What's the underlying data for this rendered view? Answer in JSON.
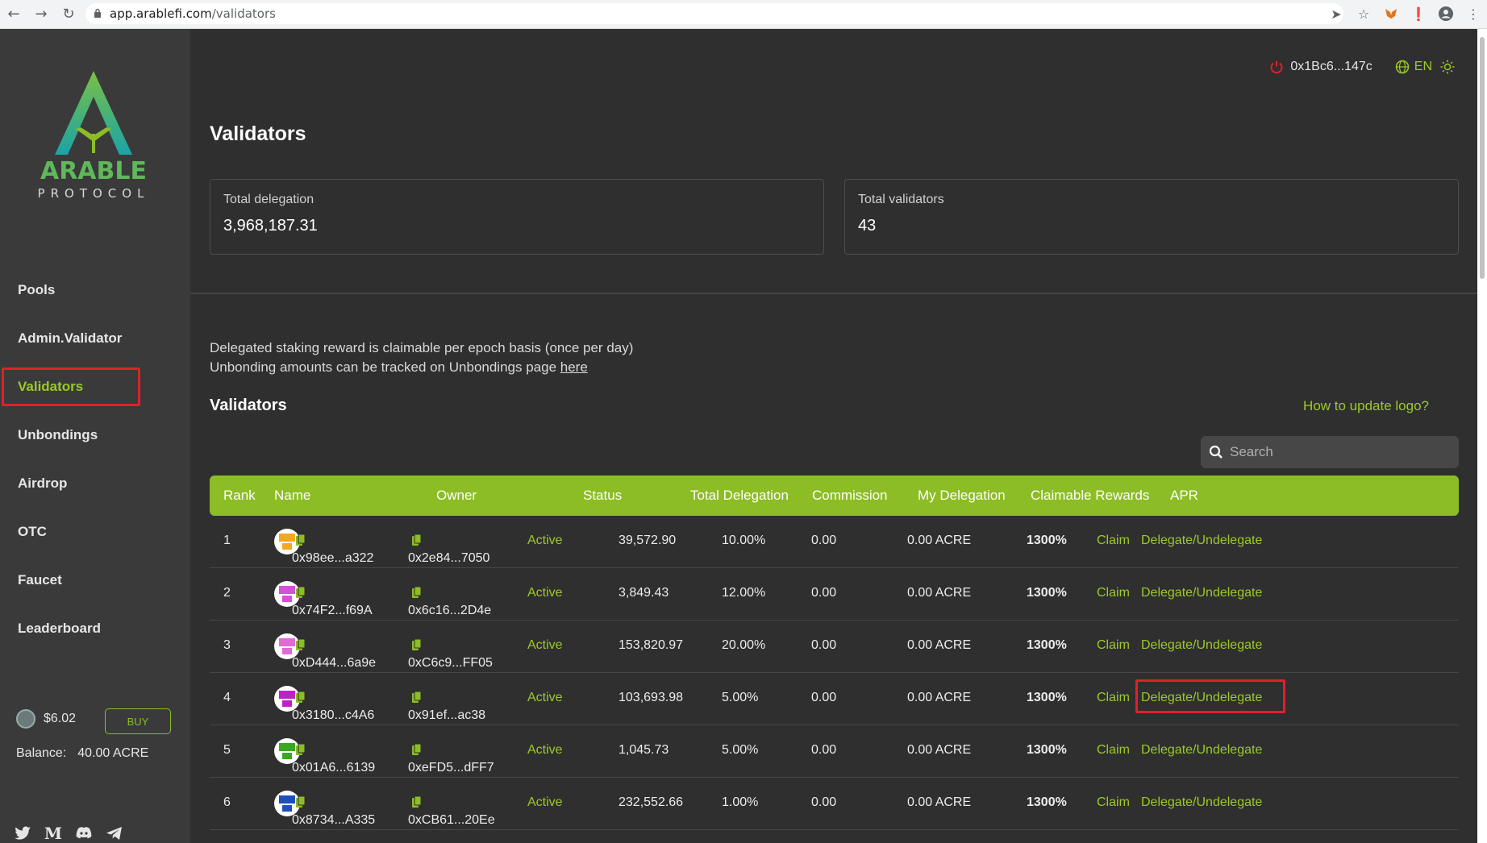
{
  "browser": {
    "domain": "app.arablefi.com",
    "path": "/validators"
  },
  "sidebar": {
    "logo_text": "ARABLE",
    "logo_sub": "PROTOCOL",
    "items": [
      {
        "label": "Pools"
      },
      {
        "label": "Admin.Validator"
      },
      {
        "label": "Validators"
      },
      {
        "label": "Unbondings"
      },
      {
        "label": "Airdrop"
      },
      {
        "label": "OTC"
      },
      {
        "label": "Faucet"
      },
      {
        "label": "Leaderboard"
      }
    ],
    "active_index": 2,
    "price": "$6.02",
    "buy_label": "BUY",
    "balance_label": "Balance:",
    "balance_value": "40.00 ACRE",
    "socials": [
      "twitter-icon",
      "medium-icon",
      "discord-icon",
      "telegram-icon"
    ]
  },
  "header": {
    "wallet": "0x1Bc6...147c",
    "lang": "EN"
  },
  "page": {
    "title": "Validators",
    "total_delegation_label": "Total delegation",
    "total_delegation_value": "3,968,187.31",
    "total_validators_label": "Total validators",
    "total_validators_value": "43",
    "note_line1": "Delegated staking reward is claimable per epoch basis (once per day)",
    "note_line2_prefix": "Unbonding amounts can be tracked on Unbondings page",
    "note_link": "here",
    "section_title": "Validators",
    "update_logo_link": "How to update logo?",
    "search_placeholder": "Search"
  },
  "table": {
    "headers": {
      "rank": "Rank",
      "name": "Name",
      "owner": "Owner",
      "status": "Status",
      "total_delegation": "Total Delegation",
      "commission": "Commission",
      "my_delegation": "My Delegation",
      "claimable_rewards": "Claimable Rewards",
      "apr": "APR"
    },
    "claim_label": "Claim",
    "delegate_label": "Delegate/Undelegate",
    "rows": [
      {
        "rank": "1",
        "name": "0x98ee...a322",
        "owner": "0x2e84...7050",
        "status": "Active",
        "total": "39,572.90",
        "commission": "10.00%",
        "my": "0.00",
        "rewards": "0.00 ACRE",
        "apr": "1300%",
        "avatar_color": "#f5a623"
      },
      {
        "rank": "2",
        "name": "0x74F2...f69A",
        "owner": "0x6c16...2D4e",
        "status": "Active",
        "total": "3,849.43",
        "commission": "12.00%",
        "my": "0.00",
        "rewards": "0.00 ACRE",
        "apr": "1300%",
        "avatar_color": "#d64fd6"
      },
      {
        "rank": "3",
        "name": "0xD444...6a9e",
        "owner": "0xC6c9...FF05",
        "status": "Active",
        "total": "153,820.97",
        "commission": "20.00%",
        "my": "0.00",
        "rewards": "0.00 ACRE",
        "apr": "1300%",
        "avatar_color": "#e06ad8"
      },
      {
        "rank": "4",
        "name": "0x3180...c4A6",
        "owner": "0x91ef...ac38",
        "status": "Active",
        "total": "103,693.98",
        "commission": "5.00%",
        "my": "0.00",
        "rewards": "0.00 ACRE",
        "apr": "1300%",
        "avatar_color": "#c21fc7"
      },
      {
        "rank": "5",
        "name": "0x01A6...6139",
        "owner": "0xeFD5...dFF7",
        "status": "Active",
        "total": "1,045.73",
        "commission": "5.00%",
        "my": "0.00",
        "rewards": "0.00 ACRE",
        "apr": "1300%",
        "avatar_color": "#3aa81e"
      },
      {
        "rank": "6",
        "name": "0x8734...A335",
        "owner": "0xCB61...20Ee",
        "status": "Active",
        "total": "232,552.66",
        "commission": "1.00%",
        "my": "0.00",
        "rewards": "0.00 ACRE",
        "apr": "1300%",
        "avatar_color": "#1f4fb8"
      }
    ],
    "highlighted_row": 3
  },
  "colors": {
    "accent": "#8cbd25",
    "highlight": "#e0202a",
    "background": "#2f2f2f",
    "sidebar": "#3a3a3a"
  }
}
